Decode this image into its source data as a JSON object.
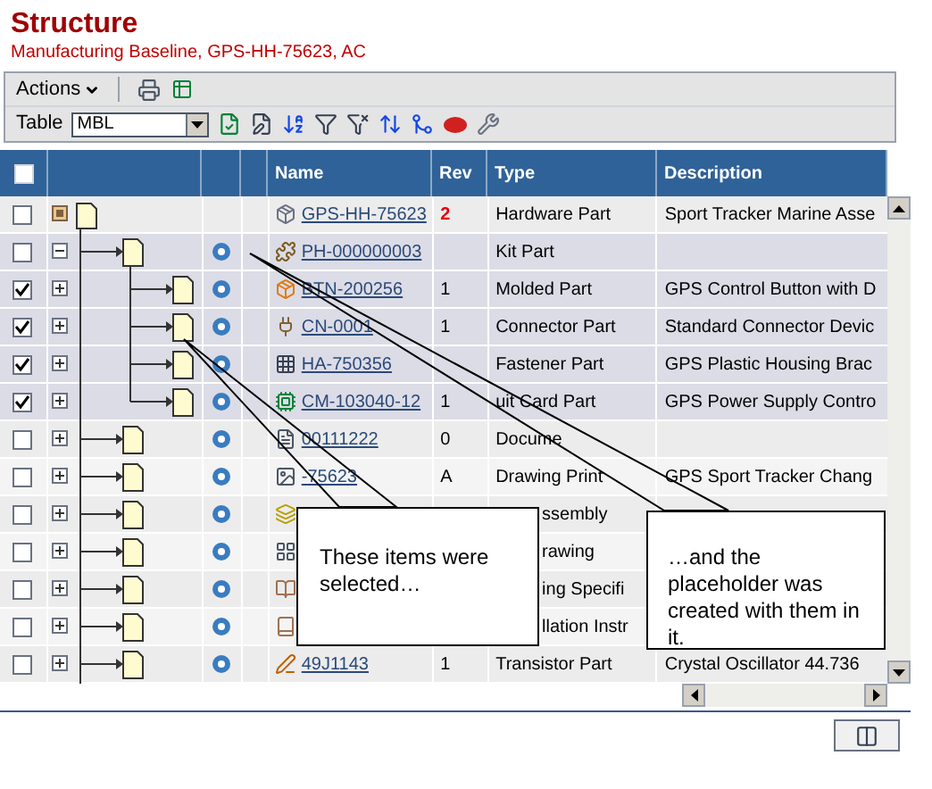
{
  "title": "Structure",
  "subtitle": "Manufacturing Baseline, GPS-HH-75623, AC",
  "actions": {
    "label": "Actions"
  },
  "table_picker": {
    "label": "Table",
    "value": "MBL"
  },
  "columns": [
    "Name",
    "Rev",
    "Type",
    "Description"
  ],
  "header_checkbox": {
    "checked": false
  },
  "rows": [
    {
      "kind": "row",
      "checked": false,
      "expanded": true,
      "rev_alert": true,
      "name": "GPS-HH-75623",
      "rev": "2",
      "type": "Hardware Part",
      "description": "Sport Tracker Marine Asse",
      "children": [
        {
          "kind": "row",
          "checked": false,
          "expanded": true,
          "rev_alert": false,
          "name": "PH-000000003",
          "type": "Kit Part",
          "children": [
            {
              "kind": "row",
              "checked": true,
              "expanded": false,
              "rev_alert": false,
              "name": "BTN-200256",
              "rev": "1",
              "type": "Molded Part",
              "description": "GPS Control Button with D"
            },
            {
              "kind": "row",
              "checked": true,
              "expanded": false,
              "rev_alert": false,
              "name": "CN-0001",
              "rev": "1",
              "type": "Connector Part",
              "description": "Standard Connector Devic"
            },
            {
              "kind": "row",
              "checked": true,
              "expanded": false,
              "rev_alert": false,
              "name": "HA-750356",
              "type": "Fastener Part",
              "description": "GPS Plastic Housing Brac"
            },
            {
              "kind": "row",
              "checked": true,
              "expanded": false,
              "rev_alert": false,
              "name": "CM-103040-12",
              "rev": "1",
              "type": "uit Card Part",
              "description": "GPS Power Supply Contro"
            }
          ]
        },
        {
          "kind": "row",
          "checked": false,
          "expanded": false,
          "rev_alert": false,
          "name": "00111222",
          "rev": "0",
          "type": "Docume"
        },
        {
          "kind": "row",
          "checked": false,
          "expanded": false,
          "rev_alert": false,
          "name": "-75623",
          "rev": "A",
          "type": "Drawing Print",
          "description": "GPS Sport Tracker Chang"
        },
        {
          "kind": "covered",
          "checked": false,
          "expanded": false,
          "type": "ssembly"
        },
        {
          "kind": "covered",
          "checked": false,
          "expanded": false,
          "type": "rawing"
        },
        {
          "kind": "covered",
          "checked": false,
          "expanded": false,
          "type": "ing Specifi"
        },
        {
          "kind": "covered",
          "checked": false,
          "expanded": false,
          "type": "llation Instr"
        },
        {
          "kind": "row",
          "checked": false,
          "expanded": false,
          "rev_alert": false,
          "name": "49J1143",
          "rev": "1",
          "type": "Transistor Part",
          "description": "Crystal Oscillator 44.736"
        }
      ]
    }
  ],
  "callouts": [
    "These items were selected…",
    "…and the placeholder was created with them in it."
  ]
}
